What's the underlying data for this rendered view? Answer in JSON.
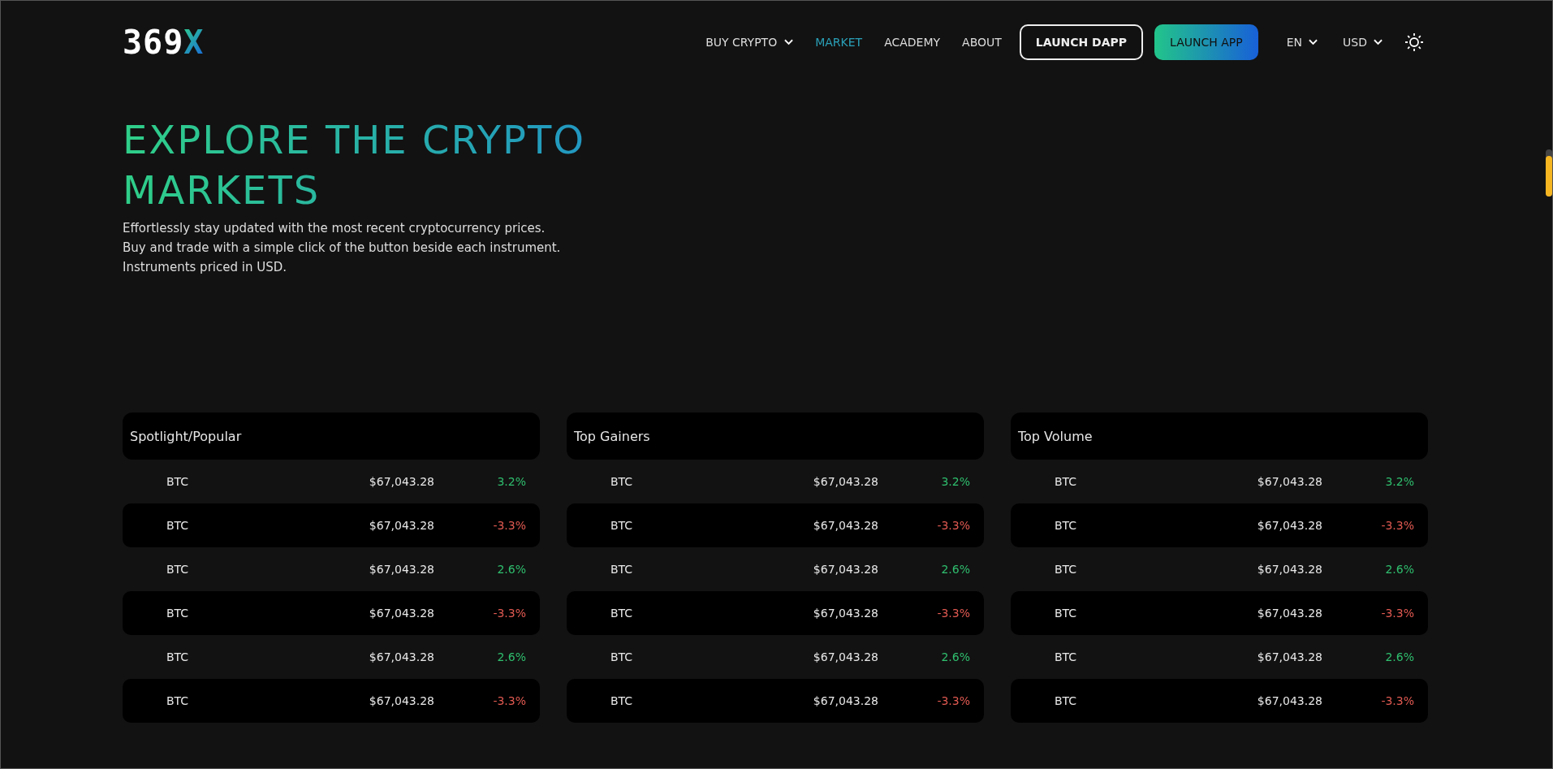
{
  "logo": {
    "text": "369",
    "accent": "X"
  },
  "nav": [
    {
      "label": "BUY CRYPTO",
      "dropdown": true,
      "selected": false
    },
    {
      "label": "MARKET",
      "dropdown": false,
      "selected": true
    },
    {
      "label": "ACADEMY",
      "dropdown": false,
      "selected": false
    },
    {
      "label": "ABOUT",
      "dropdown": false,
      "selected": false
    }
  ],
  "buttons": [
    {
      "label": "LAUNCH DAPP",
      "kind": "outline"
    },
    {
      "label": "LAUNCH APP",
      "kind": "gradient"
    }
  ],
  "selectors": [
    {
      "label": "EN"
    },
    {
      "label": "USD"
    }
  ],
  "hero": {
    "title": "EXPLORE THE CRYPTO MARKETS",
    "lines": [
      "Effortlessly stay updated with the most recent cryptocurrency prices.",
      "Buy and trade with a simple click of the button beside each instrument.",
      "Instruments priced in USD."
    ]
  },
  "panels": [
    {
      "title": "Spotlight/Popular",
      "rows": [
        {
          "symbol": "BTC",
          "price": "$67,043.28",
          "change": "3.2%",
          "positive": true
        },
        {
          "symbol": "BTC",
          "price": "$67,043.28",
          "change": "-3.3%",
          "positive": false
        },
        {
          "symbol": "BTC",
          "price": "$67,043.28",
          "change": "2.6%",
          "positive": true
        },
        {
          "symbol": "BTC",
          "price": "$67,043.28",
          "change": "-3.3%",
          "positive": false
        },
        {
          "symbol": "BTC",
          "price": "$67,043.28",
          "change": "2.6%",
          "positive": true
        },
        {
          "symbol": "BTC",
          "price": "$67,043.28",
          "change": "-3.3%",
          "positive": false
        }
      ]
    },
    {
      "title": "Top Gainers",
      "rows": [
        {
          "symbol": "BTC",
          "price": "$67,043.28",
          "change": "3.2%",
          "positive": true
        },
        {
          "symbol": "BTC",
          "price": "$67,043.28",
          "change": "-3.3%",
          "positive": false
        },
        {
          "symbol": "BTC",
          "price": "$67,043.28",
          "change": "2.6%",
          "positive": true
        },
        {
          "symbol": "BTC",
          "price": "$67,043.28",
          "change": "-3.3%",
          "positive": false
        },
        {
          "symbol": "BTC",
          "price": "$67,043.28",
          "change": "2.6%",
          "positive": true
        },
        {
          "symbol": "BTC",
          "price": "$67,043.28",
          "change": "-3.3%",
          "positive": false
        }
      ]
    },
    {
      "title": "Top Volume",
      "rows": [
        {
          "symbol": "BTC",
          "price": "$67,043.28",
          "change": "3.2%",
          "positive": true
        },
        {
          "symbol": "BTC",
          "price": "$67,043.28",
          "change": "-3.3%",
          "positive": false
        },
        {
          "symbol": "BTC",
          "price": "$67,043.28",
          "change": "2.6%",
          "positive": true
        },
        {
          "symbol": "BTC",
          "price": "$67,043.28",
          "change": "-3.3%",
          "positive": false
        },
        {
          "symbol": "BTC",
          "price": "$67,043.28",
          "change": "2.6%",
          "positive": true
        },
        {
          "symbol": "BTC",
          "price": "$67,043.28",
          "change": "-3.3%",
          "positive": false
        }
      ]
    }
  ]
}
